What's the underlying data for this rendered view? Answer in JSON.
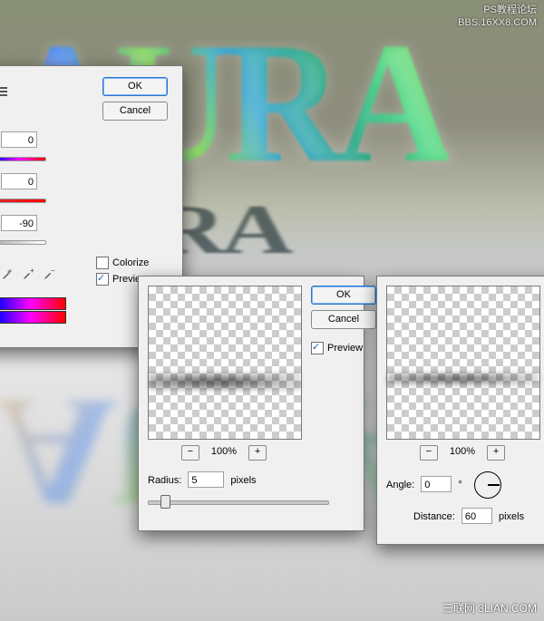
{
  "watermark_top": {
    "line1": "PS教程论坛",
    "line2": "BBS.16XX8.COM"
  },
  "watermark_bottom": "三联网 3LIAN.COM",
  "artwork": {
    "text_main": "AURA",
    "text_refl1": "URA",
    "text_refl2": "AURA"
  },
  "buttons": {
    "ok": "OK",
    "cancel": "Cancel"
  },
  "checkboxes": {
    "preview": "Preview",
    "colorize": "Colorize",
    "p_short": "P"
  },
  "hue_sat": {
    "hue_value": "0",
    "saturation_value": "0",
    "lightness_value": "-90"
  },
  "gaussian": {
    "zoom": "100%",
    "radius_label": "Radius:",
    "radius_value": "5",
    "radius_unit": "pixels"
  },
  "motion": {
    "zoom": "100%",
    "angle_label": "Angle:",
    "angle_value": "0",
    "angle_unit": "°",
    "distance_label": "Distance:",
    "distance_value": "60",
    "distance_unit": "pixels"
  }
}
